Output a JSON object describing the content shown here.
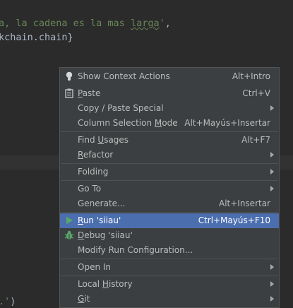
{
  "editor": {
    "line1_string": "a, la cadena es la mas larga'",
    "line1_typo_word": "larga",
    "line1_suffix": ",",
    "line2": "kchain.chain}",
    "line3": ".')"
  },
  "menu": {
    "items": [
      {
        "label": "Show Context Actions",
        "shortcut": "Alt+Intro",
        "icon": "lightbulb-icon"
      },
      {
        "label": "Paste",
        "shortcut": "Ctrl+V",
        "icon": "clipboard-icon"
      },
      {
        "label": "Copy / Paste Special",
        "submenu": true
      },
      {
        "label": "Column Selection Mode",
        "shortcut": "Alt+Mayús+Insertar"
      },
      {
        "label": "Find Usages",
        "shortcut": "Alt+F7"
      },
      {
        "label": "Refactor",
        "submenu": true
      },
      {
        "label": "Folding",
        "submenu": true
      },
      {
        "label": "Go To",
        "submenu": true
      },
      {
        "label": "Generate...",
        "shortcut": "Alt+Insertar"
      },
      {
        "label": "Run 'siiau'",
        "shortcut": "Ctrl+Mayús+F10",
        "icon": "run-icon",
        "selected": true
      },
      {
        "label": "Debug 'siiau'",
        "icon": "debug-icon"
      },
      {
        "label": "Modify Run Configuration..."
      },
      {
        "label": "Open In",
        "submenu": true
      },
      {
        "label": "Local History",
        "submenu": true
      },
      {
        "label": "Git",
        "submenu": true
      }
    ]
  },
  "colors": {
    "selection": "#4b6eaf",
    "run_icon": "#59a869",
    "debug_icon": "#59a869",
    "lightbulb": "#d6d6d6"
  }
}
